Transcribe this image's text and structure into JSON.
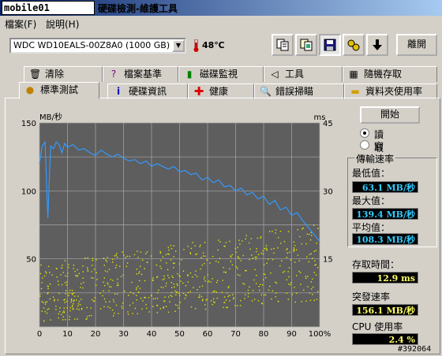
{
  "app": {
    "logo_text": "mobile01",
    "title": "硬碟檢測-維護工具"
  },
  "menu": [
    {
      "label": "檔案(F)"
    },
    {
      "label": "說明(H)"
    }
  ],
  "toolbar": {
    "drive": "WDC WD10EALS-00Z8A0 (1000 GB)",
    "temperature": "48℃",
    "buttons": [
      "copy-text-icon",
      "copy-image-icon",
      "save-icon",
      "options-icon",
      "down-arrow-icon"
    ],
    "exit_label": "離開"
  },
  "tabs_row1": [
    {
      "label": "清除",
      "icon": "trash-icon"
    },
    {
      "label": "檔案基準",
      "icon": "file-benchmark-icon"
    },
    {
      "label": "磁碟監視",
      "icon": "disk-monitor-icon"
    },
    {
      "label": "工具",
      "icon": "speaker-icon"
    },
    {
      "label": "隨機存取",
      "icon": "random-access-icon"
    }
  ],
  "tabs_row2": [
    {
      "label": "標準測試",
      "icon": "benchmark-icon"
    },
    {
      "label": "硬碟資訊",
      "icon": "info-icon"
    },
    {
      "label": "健康",
      "icon": "health-icon"
    },
    {
      "label": "錯誤掃瞄",
      "icon": "error-scan-icon"
    },
    {
      "label": "資料夾使用率",
      "icon": "folder-icon"
    }
  ],
  "controls": {
    "start_label": "開始",
    "read_label": "讀取",
    "write_label": "寫入",
    "mode": "read"
  },
  "stats": {
    "transfer_rate_title": "傳輸速率",
    "min_label": "最低值：",
    "min_value": "63.1 MB/秒",
    "max_label": "最大值：",
    "max_value": "139.4 MB/秒",
    "avg_label": "平均值：",
    "avg_value": "108.3 MB/秒",
    "access_time_label": "存取時間：",
    "access_time_value": "12.9 ms",
    "burst_label": "突發速率",
    "burst_value": "156.1 MB/秒",
    "cpu_label": "CPU 使用率",
    "cpu_value": "2.4 %"
  },
  "watermark": "#392064",
  "chart_data": {
    "type": "line",
    "y_left_label": "MB/秒",
    "y_right_label": "ms",
    "ylim_left": [
      0,
      150
    ],
    "ylim_right": [
      0,
      45
    ],
    "y_left_ticks": [
      "150",
      "100",
      "50"
    ],
    "y_right_ticks": [
      "45",
      "30",
      "15"
    ],
    "x_ticks": [
      "0",
      "10",
      "20",
      "30",
      "40",
      "50",
      "60",
      "70",
      "80",
      "90",
      "100%"
    ],
    "grid": true,
    "colors": {
      "background": "#5e5e5e",
      "grid": "#a8a8a8",
      "transfer": "#3399ff",
      "access": "#e6e600"
    },
    "series": [
      {
        "kind": "transfer",
        "x": [
          0,
          1,
          2,
          3,
          4,
          5,
          6,
          7,
          8,
          9,
          10,
          12,
          14,
          16,
          18,
          20,
          22,
          24,
          26,
          28,
          30,
          32,
          34,
          36,
          38,
          40,
          42,
          44,
          46,
          48,
          50,
          52,
          54,
          56,
          58,
          60,
          62,
          64,
          66,
          68,
          70,
          72,
          74,
          76,
          78,
          80,
          82,
          84,
          86,
          88,
          90,
          92,
          94,
          96,
          98,
          100
        ],
        "y": [
          120,
          133,
          136,
          80,
          133,
          131,
          136,
          134,
          128,
          135,
          132,
          134,
          130,
          131,
          128,
          126,
          130,
          127,
          125,
          127,
          124,
          122,
          123,
          120,
          122,
          118,
          120,
          118,
          116,
          118,
          114,
          115,
          112,
          113,
          108,
          110,
          106,
          108,
          103,
          104,
          100,
          102,
          97,
          99,
          94,
          96,
          90,
          93,
          86,
          88,
          82,
          84,
          78,
          73,
          68,
          63
        ]
      },
      {
        "kind": "access",
        "x_range": [
          0,
          100
        ],
        "y_ms_min_at_start": 1,
        "y_ms_max_at_start": 14,
        "y_ms_min_at_end": 6,
        "y_ms_max_at_end": 23
      }
    ]
  }
}
